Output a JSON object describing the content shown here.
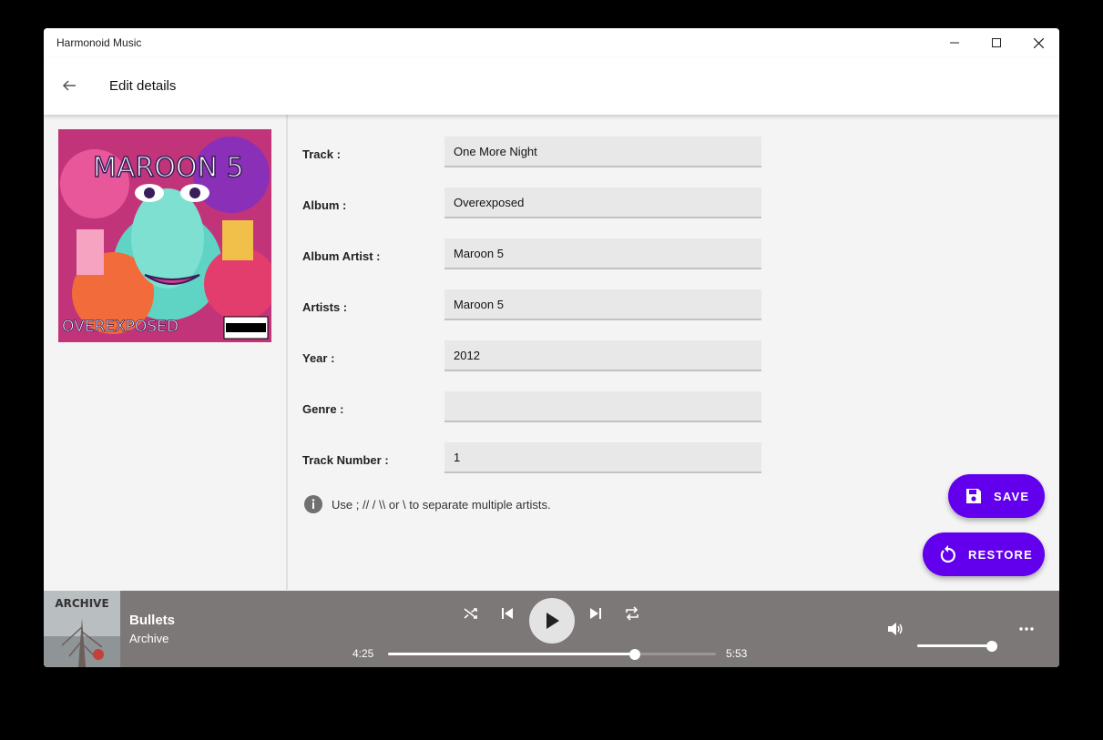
{
  "window": {
    "title": "Harmonoid Music"
  },
  "header": {
    "title": "Edit details"
  },
  "album_art": {
    "band_text": "MAROON 5",
    "album_text": "OVEREXPOSED",
    "advisory_text": "PARENTAL ADVISORY EXPLICIT CONTENT"
  },
  "form": {
    "fields": [
      {
        "label": "Track :",
        "value": "One More Night"
      },
      {
        "label": "Album :",
        "value": "Overexposed"
      },
      {
        "label": "Album Artist :",
        "value": "Maroon 5"
      },
      {
        "label": "Artists :",
        "value": "Maroon 5"
      },
      {
        "label": "Year :",
        "value": "2012"
      },
      {
        "label": "Genre :",
        "value": ""
      },
      {
        "label": "Track Number :",
        "value": "1"
      }
    ],
    "hint": "Use ; // / \\\\ or \\ to separate multiple artists."
  },
  "actions": {
    "save_label": "SAVE",
    "restore_label": "RESTORE"
  },
  "colors": {
    "accent": "#6200ee",
    "player_bg": "#7d7878"
  },
  "player": {
    "title": "Bullets",
    "artist": "Archive",
    "art_text": "ARCHIVE",
    "current_time": "4:25",
    "total_time": "5:53",
    "progress": 0.753,
    "volume": 0.98,
    "icons": [
      "shuffle-icon",
      "skip-previous-icon",
      "play-icon",
      "skip-next-icon",
      "repeat-icon",
      "volume-icon",
      "more-icon"
    ]
  }
}
